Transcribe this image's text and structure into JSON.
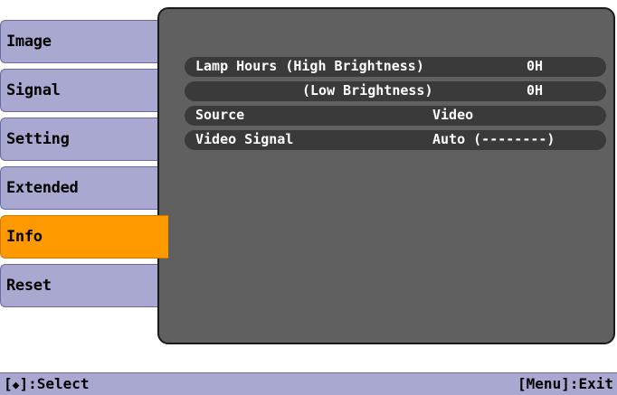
{
  "menu": {
    "tabs": [
      {
        "label": "Image"
      },
      {
        "label": "Signal"
      },
      {
        "label": "Setting"
      },
      {
        "label": "Extended"
      },
      {
        "label": "Info",
        "active": true
      },
      {
        "label": "Reset"
      }
    ]
  },
  "info": {
    "lamp_hours_high_label": "Lamp Hours (High Brightness)",
    "lamp_hours_high_value": "0H",
    "lamp_hours_low_label": "(Low Brightness)",
    "lamp_hours_low_value": "0H",
    "source_label": "Source",
    "source_value": "Video",
    "video_signal_label": "Video Signal",
    "video_signal_value": "Auto (--------)"
  },
  "statusbar": {
    "select_open": "[",
    "select_icon": "up-down-arrow-icon",
    "select_close": "]:Select",
    "exit": "[Menu]:Exit"
  },
  "colors": {
    "tab_bg": "#a8a8d0",
    "tab_active_bg": "#ff9900",
    "panel_bg": "#606060",
    "row_bg": "#3a3a3a",
    "text_light": "#ffffff"
  }
}
